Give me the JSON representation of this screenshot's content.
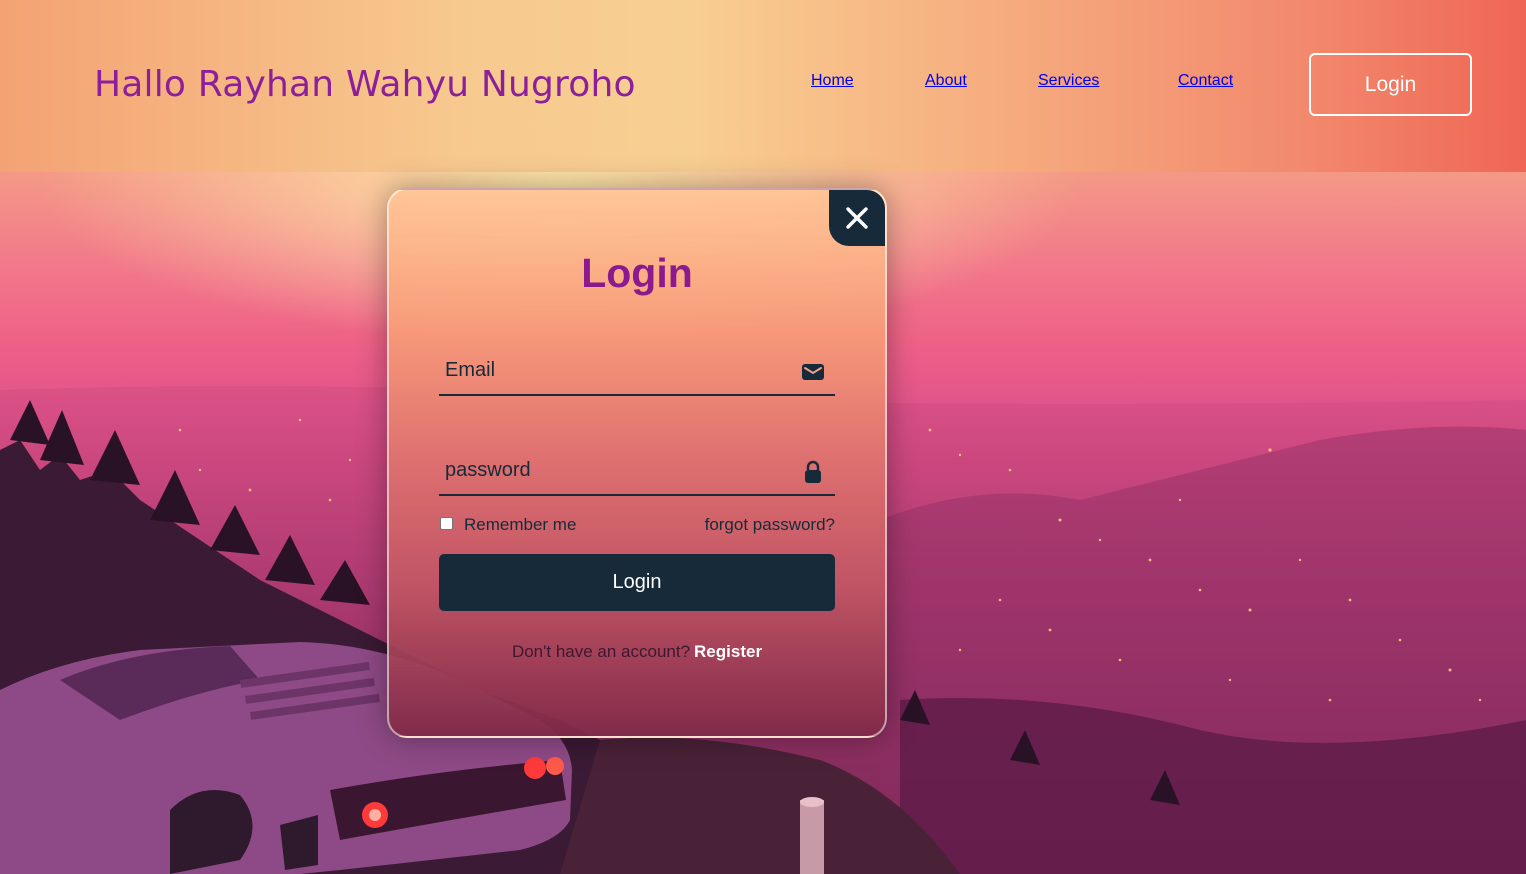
{
  "header": {
    "brand": "Hallo Rayhan Wahyu Nugroho",
    "nav": [
      {
        "label": "Home"
      },
      {
        "label": "About"
      },
      {
        "label": "Services"
      },
      {
        "label": "Contact"
      }
    ],
    "login_button": "Login"
  },
  "modal": {
    "close_icon": "close-icon",
    "title": "Login",
    "email": {
      "placeholder": "Email",
      "value": "",
      "icon": "mail-icon"
    },
    "password": {
      "placeholder": "password",
      "value": "",
      "icon": "lock-icon"
    },
    "remember_label": "Remember me",
    "remember_checked": false,
    "forgot_label": "forgot password?",
    "submit_label": "Login",
    "register_prompt": "Don't have an account?",
    "register_link": "Register"
  },
  "colors": {
    "brand_text": "#8c1f9a",
    "nav_text": "#9a1fb5",
    "dark_navy": "#172a3a",
    "modal_title": "#8a1a8e"
  }
}
